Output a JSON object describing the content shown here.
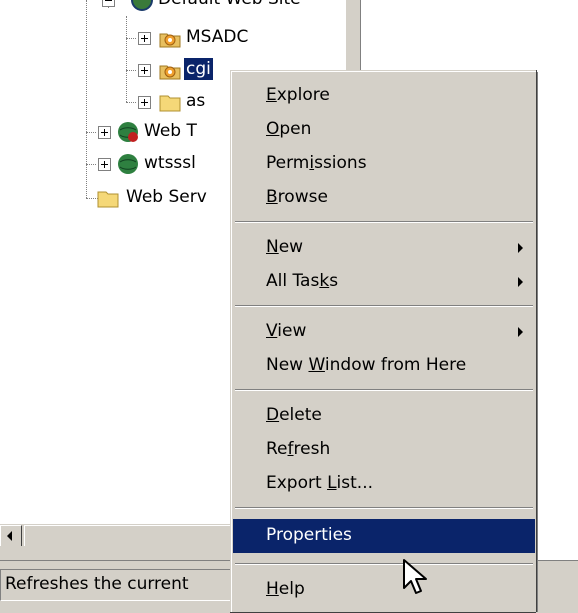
{
  "tree": {
    "partial_top_label": "Default Web Site",
    "items": [
      {
        "label": "MSADC",
        "icon": "gear-folder-icon"
      },
      {
        "label": "cgi",
        "icon": "gear-folder-icon",
        "selected": true
      },
      {
        "label": "as",
        "icon": "folder-icon"
      },
      {
        "label": "Web T",
        "icon": "globe-icon"
      },
      {
        "label": "wtsssl",
        "icon": "globe-icon"
      },
      {
        "label": "Web Serv",
        "icon": "folder-icon"
      }
    ]
  },
  "status_bar": {
    "text": "Refreshes the current"
  },
  "context_menu": {
    "items": [
      {
        "label": "Explore",
        "access_key": "E",
        "submenu": false
      },
      {
        "label": "Open",
        "access_key": "O",
        "submenu": false
      },
      {
        "label": "Permissions",
        "access_key": "i",
        "submenu": false
      },
      {
        "label": "Browse",
        "access_key": "B",
        "submenu": false
      },
      {
        "label": "New",
        "access_key": "N",
        "submenu": true
      },
      {
        "label": "All Tasks",
        "access_key": "k",
        "submenu": true
      },
      {
        "label": "View",
        "access_key": "V",
        "submenu": true
      },
      {
        "label": "New Window from Here",
        "access_key": "W",
        "submenu": false
      },
      {
        "label": "Delete",
        "access_key": "D",
        "submenu": false
      },
      {
        "label": "Refresh",
        "access_key": "f",
        "submenu": false
      },
      {
        "label": "Export List...",
        "access_key": "L",
        "submenu": false
      },
      {
        "label": "Properties",
        "access_key": "",
        "submenu": false,
        "highlighted": true
      },
      {
        "label": "Help",
        "access_key": "H",
        "submenu": false
      }
    ]
  },
  "colors": {
    "selection": "#0a246a",
    "chrome": "#d4d0c8"
  }
}
